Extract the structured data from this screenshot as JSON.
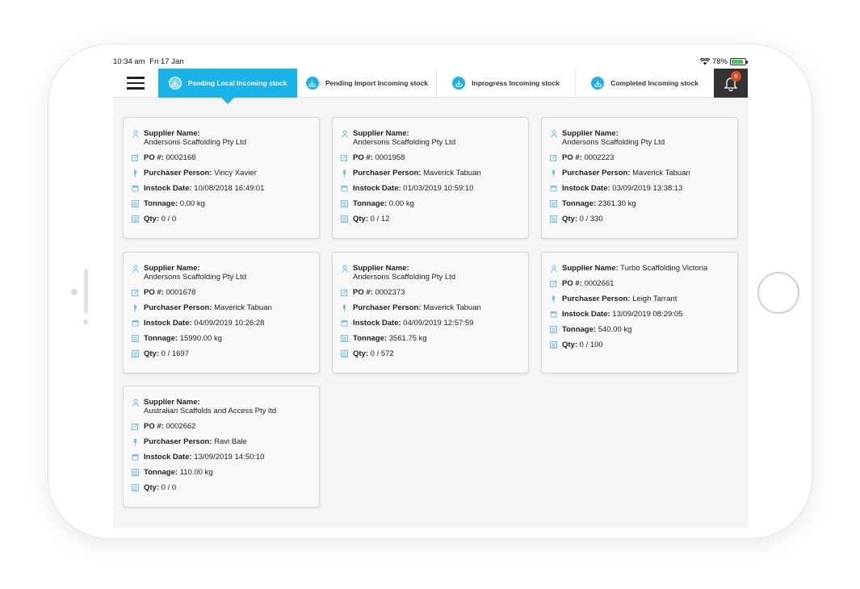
{
  "status_bar": {
    "time": "10:34 am",
    "date": "Fri 17 Jan",
    "battery": "78%"
  },
  "tabs": [
    {
      "label": "Pending Local Incoming stock",
      "active": true
    },
    {
      "label": "Pending Import Incoming stock",
      "active": false
    },
    {
      "label": "Inprogress Incoming stock",
      "active": false
    },
    {
      "label": "Completed Incoming stock",
      "active": false
    }
  ],
  "notifications": {
    "count": "0"
  },
  "labels": {
    "supplier": "Supplier Name:",
    "po": "PO #:",
    "purchaser": "Purchaser Person:",
    "instock": "Instock Date:",
    "tonnage": "Tonnage:",
    "qty": "Qty:"
  },
  "colors": {
    "accent": "#1bb2e8",
    "badge": "#e8481e",
    "icon": "#6fbfe6"
  },
  "icons": [
    "menu-icon",
    "download-icon",
    "bell-icon",
    "person-icon",
    "edit-icon",
    "microphone-icon",
    "calendar-icon",
    "scale-icon"
  ],
  "orders": [
    {
      "supplier": "Andersons Scaffolding Pty Ltd",
      "po": "0002168",
      "purchaser": "Vincy Xavier",
      "instock": "10/08/2018 16:49:01",
      "tonnage": "0.00 kg",
      "qty": "0 / 0"
    },
    {
      "supplier": "Andersons Scaffolding Pty Ltd",
      "po": "0001958",
      "purchaser": "Maverick Tabuan",
      "instock": "01/03/2019 10:59:10",
      "tonnage": "0.00 kg",
      "qty": "0 / 12"
    },
    {
      "supplier": "Andersons Scaffolding Pty Ltd",
      "po": "0002223",
      "purchaser": "Maverick Tabuan",
      "instock": "03/09/2019 13:38:13",
      "tonnage": "2361.30 kg",
      "qty": "0 / 330"
    },
    {
      "supplier": "Andersons Scaffolding Pty Ltd",
      "po": "0001678",
      "purchaser": "Maverick Tabuan",
      "instock": "04/09/2019 10:26:28",
      "tonnage": "15990.00 kg",
      "qty": "0 / 1697"
    },
    {
      "supplier": "Andersons Scaffolding Pty Ltd",
      "po": "0002373",
      "purchaser": "Maverick Tabuan",
      "instock": "04/09/2019 12:57:59",
      "tonnage": "3561.75 kg",
      "qty": "0 / 572"
    },
    {
      "supplier": "Turbo Scaffolding Victoria",
      "po": "0002661",
      "purchaser": "Leigh Tarrant",
      "instock": "13/09/2019 08:29:05",
      "tonnage": "540.00 kg",
      "qty": "0 / 100"
    },
    {
      "supplier": "Australian Scaffolds and Access Pty ltd",
      "po": "0002662",
      "purchaser": "Ravi Bale",
      "instock": "13/09/2019 14:50:10",
      "tonnage": "110.00 kg",
      "qty": "0 / 0"
    }
  ]
}
